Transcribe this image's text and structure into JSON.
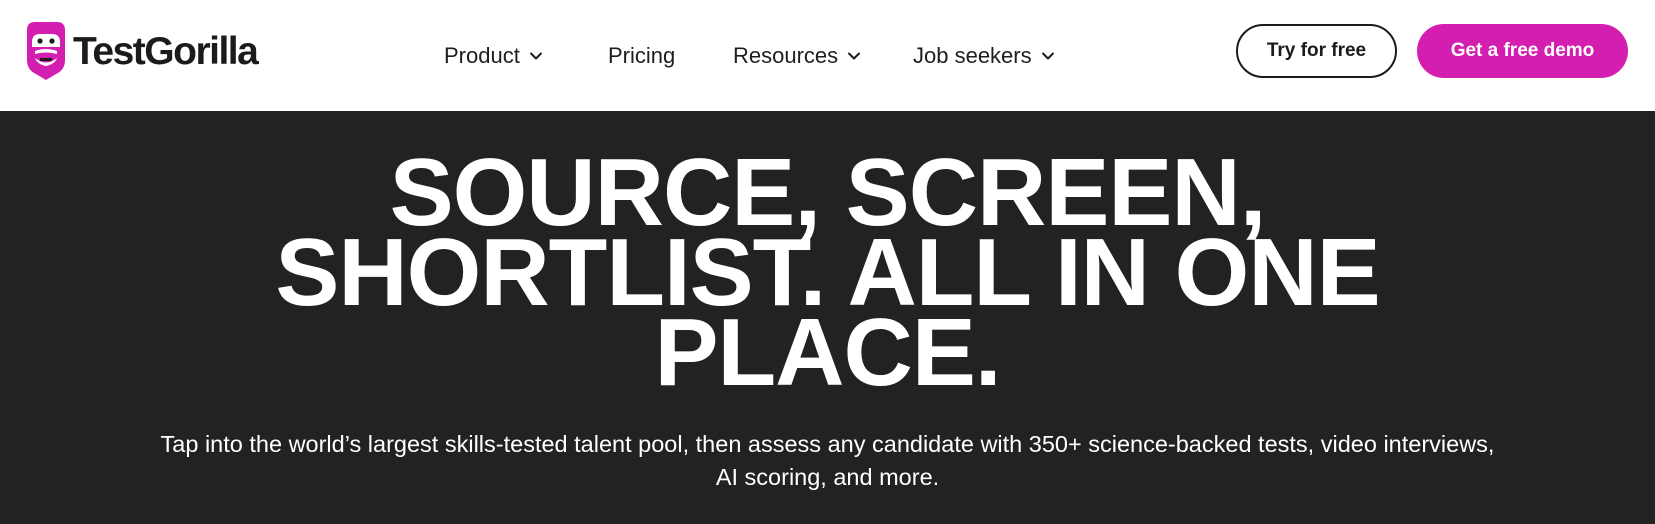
{
  "brand": {
    "name": "TestGorilla",
    "accent_color": "#d41eb0",
    "text_color": "#1b1b1b",
    "hero_background": "#222222"
  },
  "nav": {
    "items": [
      {
        "label": "Product",
        "has_dropdown": true
      },
      {
        "label": "Pricing",
        "has_dropdown": false
      },
      {
        "label": "Resources",
        "has_dropdown": true
      },
      {
        "label": "Job seekers",
        "has_dropdown": true
      }
    ]
  },
  "cta": {
    "try_label": "Try for free",
    "demo_label": "Get a free demo"
  },
  "hero": {
    "title_lines": [
      "SOURCE, SCREEN,",
      "SHORTLIST. ALL IN ONE",
      "PLACE."
    ],
    "subtitle": "Tap into the world’s largest skills-tested talent pool, then assess any candidate with 350+ science-backed tests, video interviews, AI scoring, and more."
  },
  "icons": {
    "logo": "gorilla-logo-icon",
    "dropdown": "chevron-down-icon"
  }
}
